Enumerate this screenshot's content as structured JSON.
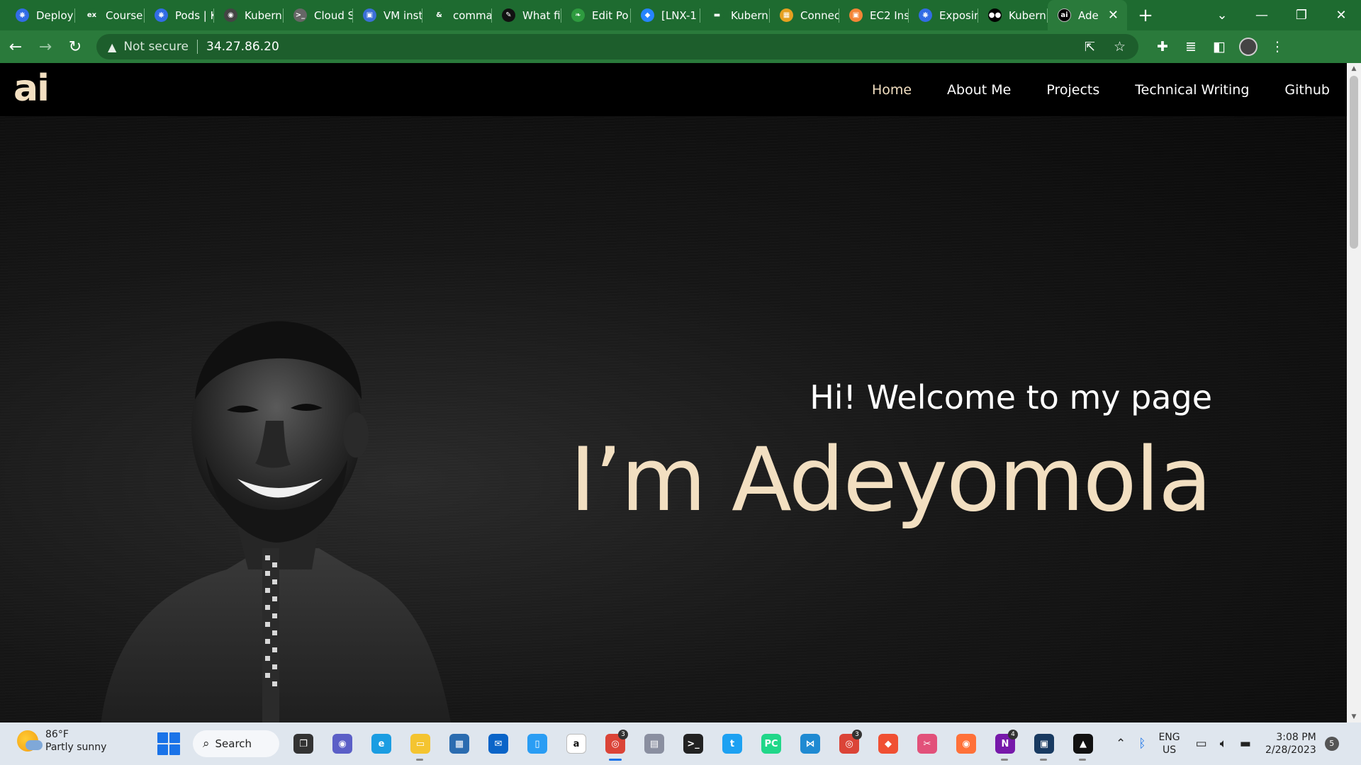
{
  "browser": {
    "tabs": [
      {
        "title": "Deploy",
        "icon": "kubernetes-icon",
        "color": "#326ce5",
        "glyph": "⎈"
      },
      {
        "title": "Course",
        "icon": "edx-icon",
        "color": "#1e6b30",
        "glyph": "ex"
      },
      {
        "title": "Pods | K",
        "icon": "kubernetes-icon",
        "color": "#326ce5",
        "glyph": "⎈"
      },
      {
        "title": "Kubern",
        "icon": "github-icon",
        "color": "#444",
        "glyph": "◉"
      },
      {
        "title": "Cloud S",
        "icon": "terminal-icon",
        "color": "#666",
        "glyph": ">_"
      },
      {
        "title": "VM inst",
        "icon": "chip-icon",
        "color": "#3b6fd6",
        "glyph": "▣"
      },
      {
        "title": "comma",
        "icon": "ampersand-icon",
        "color": "#1e6b30",
        "glyph": "&"
      },
      {
        "title": "What fi",
        "icon": "quill-icon",
        "color": "#111",
        "glyph": "✎"
      },
      {
        "title": "Edit Po",
        "icon": "leaf-icon",
        "color": "#2e9b3f",
        "glyph": "❧"
      },
      {
        "title": "[LNX-1",
        "icon": "jira-icon",
        "color": "#2684ff",
        "glyph": "◆"
      },
      {
        "title": "Kubern",
        "icon": "dash-icon",
        "color": "#1e6b30",
        "glyph": "▬"
      },
      {
        "title": "Connec",
        "icon": "box-icon",
        "color": "#e6a020",
        "glyph": "▦"
      },
      {
        "title": "EC2 Ins",
        "icon": "aws-ec2-icon",
        "color": "#f58536",
        "glyph": "▣"
      },
      {
        "title": "Exposir",
        "icon": "kubernetes-icon",
        "color": "#326ce5",
        "glyph": "⎈"
      },
      {
        "title": "Kubern",
        "icon": "medium-icon",
        "color": "#000",
        "glyph": "●●"
      }
    ],
    "active_tab": {
      "title": "Ade",
      "icon": "site-favicon-icon",
      "color": "#000",
      "glyph": "ai"
    },
    "security_label": "Not secure",
    "url": "34.27.86.20"
  },
  "site": {
    "logo": "ai",
    "nav": [
      {
        "label": "Home",
        "active": true
      },
      {
        "label": "About Me",
        "active": false
      },
      {
        "label": "Projects",
        "active": false
      },
      {
        "label": "Technical Writing",
        "active": false
      },
      {
        "label": "Github",
        "active": false
      }
    ],
    "greeting": "Hi! Welcome to my page",
    "headline": "I’m Adeyomola",
    "accent_color": "#f2dfc1"
  },
  "taskbar": {
    "weather": {
      "temp": "86°F",
      "condition": "Partly sunny"
    },
    "search_label": "Search",
    "apps": [
      {
        "name": "task-view-icon",
        "color": "#333",
        "glyph": "❐",
        "run": false,
        "badge": ""
      },
      {
        "name": "teams-chat-icon",
        "color": "#5b5fc7",
        "glyph": "◉",
        "run": false,
        "badge": ""
      },
      {
        "name": "edge-icon",
        "color": "#1b9de2",
        "glyph": "e",
        "run": false,
        "badge": ""
      },
      {
        "name": "file-explorer-icon",
        "color": "#f4c430",
        "glyph": "▭",
        "run": true,
        "badge": ""
      },
      {
        "name": "microsoft-store-icon",
        "color": "#2b6cb0",
        "glyph": "▦",
        "run": false,
        "badge": ""
      },
      {
        "name": "mail-icon",
        "color": "#0a64c8",
        "glyph": "✉",
        "run": false,
        "badge": ""
      },
      {
        "name": "notepad-icon",
        "color": "#2a9df4",
        "glyph": "▯",
        "run": false,
        "badge": ""
      },
      {
        "name": "amazon-icon",
        "color": "#fff",
        "glyph": "a",
        "run": false,
        "badge": ""
      },
      {
        "name": "chrome-icon",
        "color": "#db4437",
        "glyph": "◎",
        "run": true,
        "active": true,
        "badge": "3"
      },
      {
        "name": "book-icon",
        "color": "#8a8fa0",
        "glyph": "▤",
        "run": false,
        "badge": ""
      },
      {
        "name": "terminal-icon",
        "color": "#222",
        "glyph": ">_",
        "run": false,
        "badge": ""
      },
      {
        "name": "twitter-icon",
        "color": "#1da1f2",
        "glyph": "t",
        "run": false,
        "badge": ""
      },
      {
        "name": "pycharm-icon",
        "color": "#21d789",
        "glyph": "PC",
        "run": false,
        "badge": ""
      },
      {
        "name": "vscode-icon",
        "color": "#1f8ad2",
        "glyph": "⋈",
        "run": false,
        "badge": ""
      },
      {
        "name": "chrome-profile-icon",
        "color": "#db4437",
        "glyph": "◎",
        "run": false,
        "badge": "3"
      },
      {
        "name": "git-icon",
        "color": "#f05033",
        "glyph": "◆",
        "run": false,
        "badge": ""
      },
      {
        "name": "snipping-tool-icon",
        "color": "#e2517a",
        "glyph": "✂",
        "run": false,
        "badge": ""
      },
      {
        "name": "firefox-icon",
        "color": "#ff7139",
        "glyph": "◉",
        "run": false,
        "badge": ""
      },
      {
        "name": "onenote-icon",
        "color": "#7719aa",
        "glyph": "N",
        "run": true,
        "badge": "4"
      },
      {
        "name": "virtualbox-icon",
        "color": "#183a61",
        "glyph": "▣",
        "run": true,
        "badge": ""
      },
      {
        "name": "photos-icon",
        "color": "#111",
        "glyph": "▲",
        "run": true,
        "badge": ""
      }
    ],
    "lang": "ENG",
    "region": "US",
    "time": "3:08 PM",
    "date": "2/28/2023",
    "notifications": "5"
  }
}
